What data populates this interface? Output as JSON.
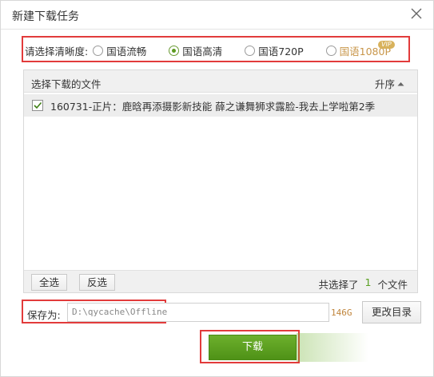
{
  "dialog": {
    "title": "新建下载任务"
  },
  "quality": {
    "label": "请选择清晰度:",
    "options": [
      {
        "label": "国语流畅",
        "selected": false,
        "vip": false
      },
      {
        "label": "国语高清",
        "selected": true,
        "vip": false
      },
      {
        "label": "国语720P",
        "selected": false,
        "vip": false
      },
      {
        "label": "国语1080P",
        "selected": false,
        "vip": true
      }
    ],
    "vip_badge": "VIP"
  },
  "file_list": {
    "header": "选择下载的文件",
    "sort_label": "升序",
    "files": [
      {
        "name": "160731-正片：鹿晗再添摄影新技能 薛之谦舞狮求露脸-我去上学啦第2季",
        "checked": true
      }
    ],
    "select_all": "全选",
    "invert": "反选",
    "status_prefix": "共选择了",
    "selected_count": "1",
    "status_suffix": "个文件"
  },
  "save": {
    "label": "保存为:",
    "path": "D:\\qycache\\Offline",
    "free_space": "146G",
    "change_dir": "更改目录"
  },
  "actions": {
    "download": "下载"
  },
  "colors": {
    "accent_green": "#5c9a1f",
    "highlight_red": "#e23b3b",
    "vip_gold": "#c8964a"
  }
}
